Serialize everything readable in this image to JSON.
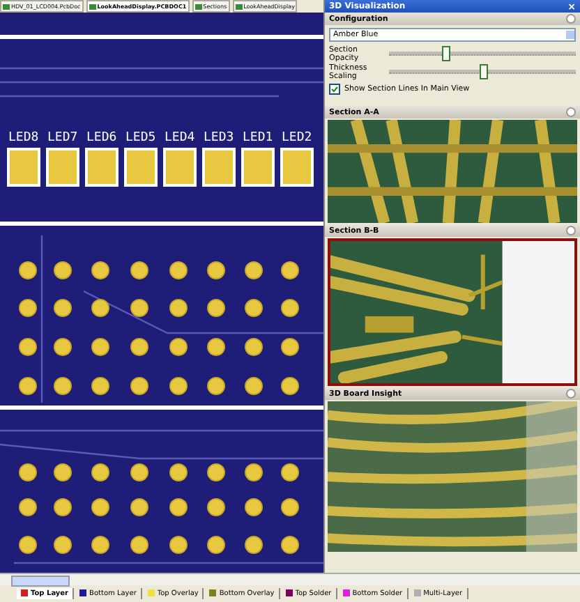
{
  "document_tabs": [
    {
      "label": "HDV_01_LCD004.PcbDoc",
      "selected": false
    },
    {
      "label": "LookAheadDisplay.PCBDOC1",
      "selected": true
    },
    {
      "label": "Sections",
      "selected": false
    },
    {
      "label": "LookAheadDisplay",
      "selected": false
    }
  ],
  "canvas": {
    "designators": [
      "LED8",
      "LED7",
      "LED6",
      "LED5",
      "LED4",
      "LED3",
      "LED1",
      "LED2"
    ]
  },
  "panel": {
    "title": "3D Visualization",
    "close": "×",
    "configuration": {
      "title": "Configuration",
      "scheme": "Amber Blue",
      "sliders": [
        {
          "label": "Section Opacity",
          "level": 0.3
        },
        {
          "label": "Thickness Scaling",
          "level": 0.5
        }
      ],
      "checkbox": {
        "label": "Show Section Lines In Main View",
        "checked": true
      }
    },
    "views": [
      {
        "title": "Section A-A",
        "kind": "section-a",
        "selected": false
      },
      {
        "title": "Section B-B",
        "kind": "section-b",
        "selected": true
      },
      {
        "title": "3D Board Insight",
        "kind": "insight",
        "selected": false
      }
    ]
  },
  "layer_tabs": [
    {
      "label": "Top Layer",
      "color": "#d02020",
      "selected": true
    },
    {
      "label": "Bottom Layer",
      "color": "#1a1a9a",
      "selected": false
    },
    {
      "label": "Top Overlay",
      "color": "#f0e040",
      "selected": false
    },
    {
      "label": "Bottom Overlay",
      "color": "#808020",
      "selected": false
    },
    {
      "label": "Top Solder",
      "color": "#800060",
      "selected": false
    },
    {
      "label": "Bottom Solder",
      "color": "#e020e0",
      "selected": false
    },
    {
      "label": "Multi-Layer",
      "color": "#b0b0b0",
      "selected": false
    }
  ]
}
